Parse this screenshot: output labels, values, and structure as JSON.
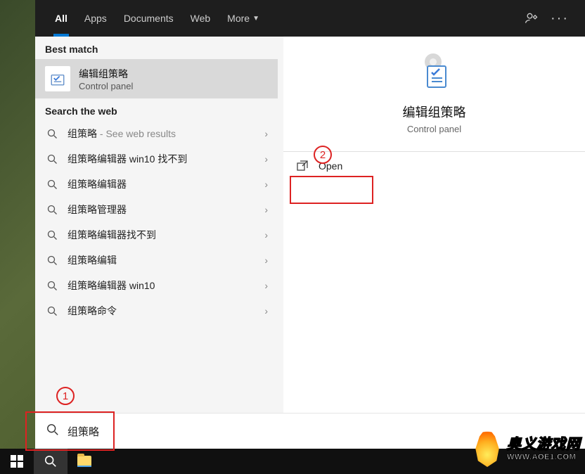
{
  "tabs": {
    "all": "All",
    "apps": "Apps",
    "documents": "Documents",
    "web": "Web",
    "more": "More"
  },
  "sections": {
    "best_match": "Best match",
    "search_web": "Search the web"
  },
  "best_match": {
    "title": "编辑组策略",
    "subtitle": "Control panel"
  },
  "web_results": [
    {
      "prefix": "组策略",
      "suffix": " - See web results"
    },
    {
      "prefix": "组策略",
      "suffix": "编辑器 win10 找不到"
    },
    {
      "prefix": "组策略",
      "suffix": "编辑器"
    },
    {
      "prefix": "组策略",
      "suffix": "管理器"
    },
    {
      "prefix": "组策略",
      "suffix": "编辑器找不到"
    },
    {
      "prefix": "组策略",
      "suffix": "编辑"
    },
    {
      "prefix": "组策略",
      "suffix": "编辑器 win10"
    },
    {
      "prefix": "组策略",
      "suffix": "命令"
    }
  ],
  "preview": {
    "title": "编辑组策略",
    "subtitle": "Control panel",
    "open": "Open"
  },
  "search": {
    "value": "组策略"
  },
  "annotations": {
    "one": "1",
    "two": "2"
  },
  "watermark": {
    "line1": "奥义游戏网",
    "line2": "WWW.AOE1.COM"
  }
}
